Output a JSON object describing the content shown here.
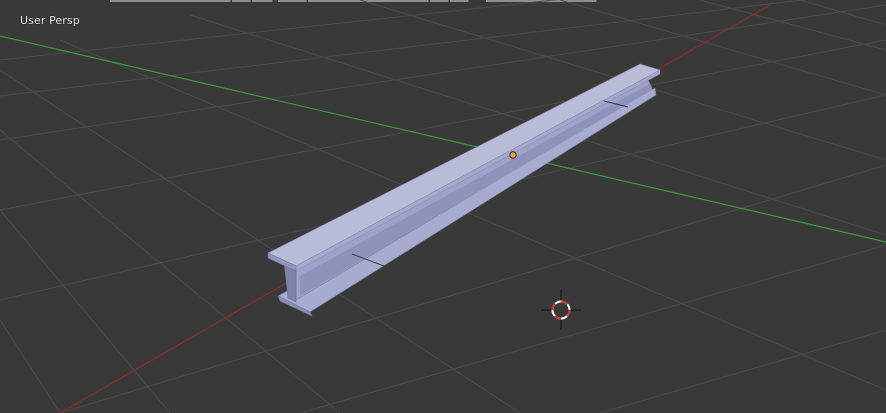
{
  "viewport": {
    "view_label": "User Persp"
  },
  "colors": {
    "background": "#393939",
    "grid": "#4a4a4a",
    "x_axis": "#8a2c2c",
    "y_axis": "#3d9b3d",
    "beam_top": "#b9bcd6",
    "beam_side": "#8f93bb",
    "beam_web": "#9ea2c8",
    "origin": "#f2a23a",
    "cursor_red": "#d42b2b"
  },
  "icons": {
    "cursor": "3d-cursor-icon",
    "origin": "object-origin-icon"
  }
}
